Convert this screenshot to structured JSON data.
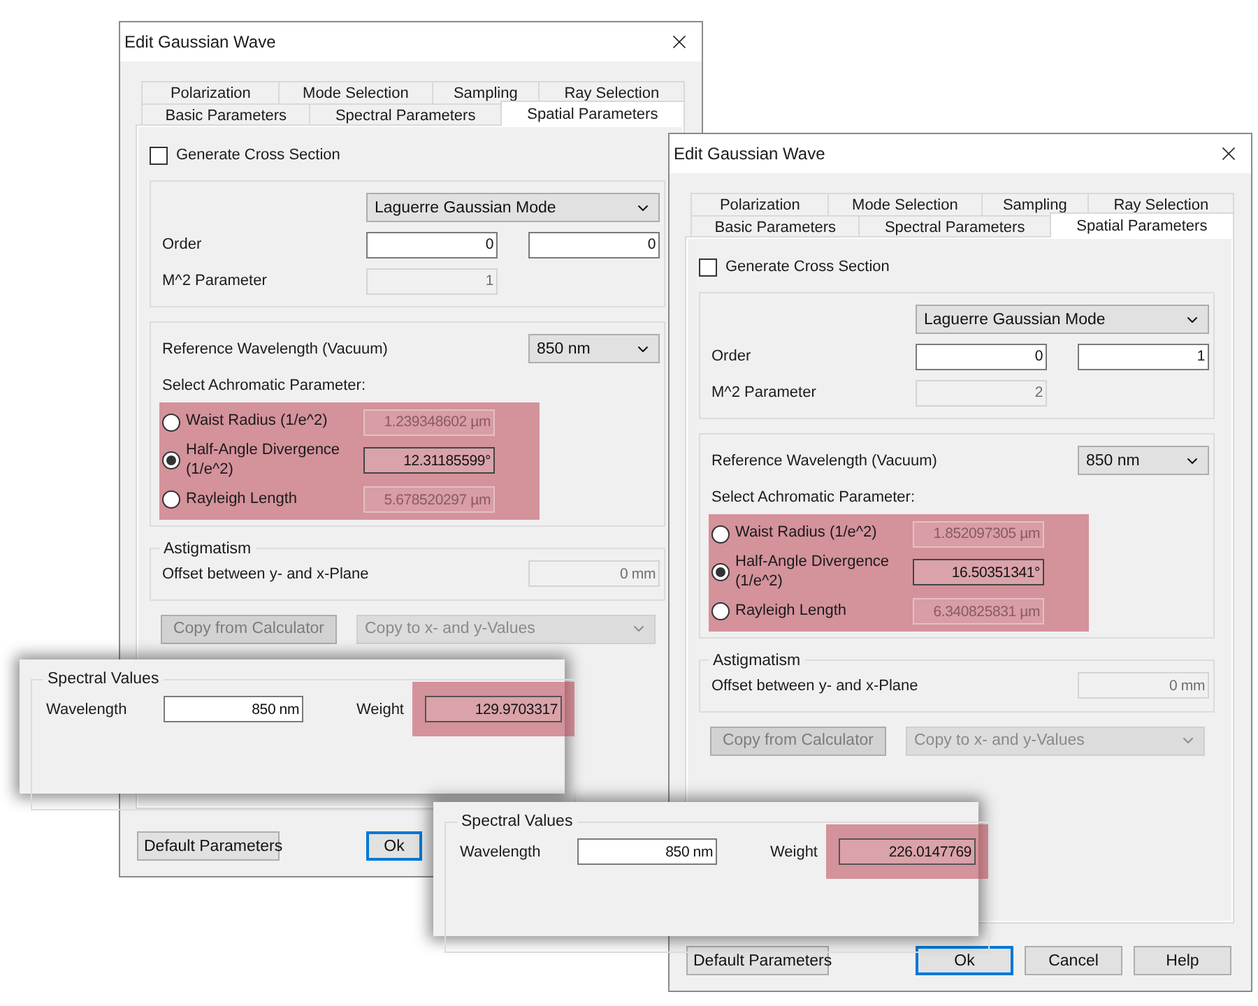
{
  "dialogs": [
    {
      "title": "Edit Gaussian Wave",
      "tabs_row1": [
        {
          "label": "Polarization",
          "selected": false
        },
        {
          "label": "Mode Selection",
          "selected": false
        },
        {
          "label": "Sampling",
          "selected": false
        },
        {
          "label": "Ray Selection",
          "selected": false
        }
      ],
      "tabs_row2": [
        {
          "label": "Basic Parameters",
          "selected": false
        },
        {
          "label": "Spectral Parameters",
          "selected": false
        },
        {
          "label": "Spatial Parameters",
          "selected": true
        }
      ],
      "cross_section": {
        "label": "Generate Cross Section",
        "checked": false
      },
      "mode": {
        "value": "Laguerre Gaussian Mode"
      },
      "order": {
        "label": "Order",
        "values": [
          "0",
          "0"
        ]
      },
      "m2": {
        "label": "M^2 Parameter",
        "value": "1",
        "disabled": true
      },
      "reference_wavelength": {
        "label": "Reference Wavelength (Vacuum)",
        "value": "850 nm"
      },
      "achromatic": {
        "label": "Select Achromatic Parameter:",
        "highlighted": true,
        "options": [
          {
            "label": "Waist Radius (1/e^2)",
            "value": "1.239348602 µm",
            "selected": false
          },
          {
            "label": "Half-Angle Divergence (1/e^2)",
            "value": "12.31185599°",
            "selected": true
          },
          {
            "label": "Rayleigh Length",
            "value": "5.678520297 µm",
            "selected": false
          }
        ]
      },
      "astigmatism": {
        "legend": "Astigmatism",
        "label": "Offset between y- and x-Plane",
        "value": "0 mm",
        "disabled": true
      },
      "copy_button": {
        "label": "Copy from Calculator",
        "disabled": true
      },
      "copy_dropdown": {
        "value": "Copy to x- and y-Values",
        "disabled": true
      },
      "buttons": [
        {
          "label": "Default Parameters",
          "kind": "normal"
        },
        {
          "label": "Ok",
          "kind": "default"
        }
      ]
    },
    {
      "title": "Edit Gaussian Wave",
      "tabs_row1": [
        {
          "label": "Polarization",
          "selected": false
        },
        {
          "label": "Mode Selection",
          "selected": false
        },
        {
          "label": "Sampling",
          "selected": false
        },
        {
          "label": "Ray Selection",
          "selected": false
        }
      ],
      "tabs_row2": [
        {
          "label": "Basic Parameters",
          "selected": false
        },
        {
          "label": "Spectral Parameters",
          "selected": false
        },
        {
          "label": "Spatial Parameters",
          "selected": true
        }
      ],
      "cross_section": {
        "label": "Generate Cross Section",
        "checked": false
      },
      "mode": {
        "value": "Laguerre Gaussian Mode"
      },
      "order": {
        "label": "Order",
        "values": [
          "0",
          "1"
        ]
      },
      "m2": {
        "label": "M^2 Parameter",
        "value": "2",
        "disabled": true
      },
      "reference_wavelength": {
        "label": "Reference Wavelength (Vacuum)",
        "value": "850 nm"
      },
      "achromatic": {
        "label": "Select Achromatic Parameter:",
        "highlighted": true,
        "options": [
          {
            "label": "Waist Radius (1/e^2)",
            "value": "1.852097305 µm",
            "selected": false
          },
          {
            "label": "Half-Angle Divergence (1/e^2)",
            "value": "16.50351341°",
            "selected": true
          },
          {
            "label": "Rayleigh Length",
            "value": "6.340825831 µm",
            "selected": false
          }
        ]
      },
      "astigmatism": {
        "legend": "Astigmatism",
        "label": "Offset between y- and x-Plane",
        "value": "0 mm",
        "disabled": true
      },
      "copy_button": {
        "label": "Copy from Calculator",
        "disabled": true
      },
      "copy_dropdown": {
        "value": "Copy to x- and y-Values",
        "disabled": true
      },
      "buttons": [
        {
          "label": "Default Parameters",
          "kind": "normal"
        },
        {
          "label": "Ok",
          "kind": "default"
        },
        {
          "label": "Cancel",
          "kind": "normal"
        },
        {
          "label": "Help",
          "kind": "normal"
        }
      ]
    }
  ],
  "callouts": [
    {
      "legend": "Spectral Values",
      "wavelength_label": "Wavelength",
      "wavelength": "850 nm",
      "weight_label": "Weight",
      "weight": "129.9703317",
      "highlighted": true
    },
    {
      "legend": "Spectral Values",
      "wavelength_label": "Wavelength",
      "wavelength": "850 nm",
      "weight_label": "Weight",
      "weight": "226.0147769",
      "highlighted": true
    }
  ]
}
